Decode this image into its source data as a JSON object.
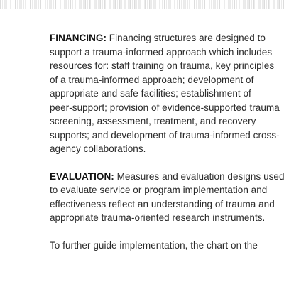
{
  "document": {
    "financing": {
      "heading": "FINANCING:",
      "lines": [
        " Financing structures are designed to",
        "support a trauma-informed approach which includes",
        "resources for: staff training on trauma, key principles",
        "of a trauma-informed approach; development of",
        "appropriate and safe facilities; establishment of",
        "peer-support; provision of evidence-supported trauma",
        "screening, assessment, treatment, and recovery",
        "supports; and development of trauma-informed cross-",
        "agency collaborations."
      ]
    },
    "evaluation": {
      "heading": "EVALUATION:",
      "lines": [
        " Measures and evaluation designs used",
        "to evaluate service or program implementation and",
        "effectiveness reflect an understanding of trauma and",
        "appropriate trauma-oriented research instruments."
      ]
    },
    "closing": {
      "lines": [
        "To further guide implementation, the chart on the"
      ]
    }
  }
}
